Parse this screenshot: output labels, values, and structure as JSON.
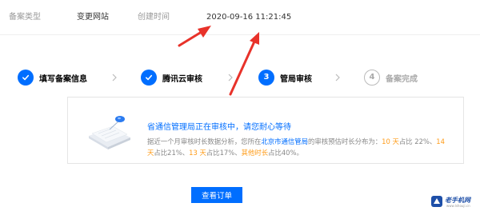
{
  "info_bar": {
    "type_label": "备案类型",
    "type_value": "变更网站",
    "time_label": "创建时间",
    "time_value": "2020-09-16 11:21:45"
  },
  "steps": [
    {
      "label": "填写备案信息",
      "status": "done",
      "icon": "check-icon"
    },
    {
      "label": "腾讯云审核",
      "status": "done",
      "icon": "check-icon"
    },
    {
      "number": "3",
      "label": "管局审核",
      "status": "active"
    },
    {
      "number": "4",
      "label": "备案完成",
      "status": "pending"
    }
  ],
  "notice": {
    "title": "省通信管理局正在审核中，请您耐心等待",
    "body": {
      "p1": "据近一个月审核时长数据分析，您所在",
      "region": "北京市通信管局",
      "p2": "的审核预估时长分布为：",
      "d1": "10 天",
      "p3": "占比 22%、",
      "d2": "14 天",
      "p4": "占比21%、",
      "d3": "13 天",
      "p5": "占比17%、",
      "d4": "其他时长",
      "p6": "占比40%。"
    }
  },
  "view_order_button": "查看订单",
  "watermark": {
    "text": "老手机网",
    "sub": "www.lshouji.cn"
  },
  "colors": {
    "primary": "#006eff",
    "highlight": "#ff9c19",
    "annotation_arrow": "#e8322a"
  }
}
